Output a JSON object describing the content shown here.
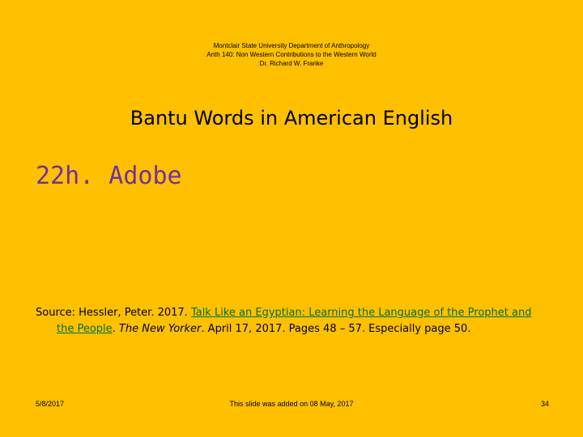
{
  "header": {
    "line1": "Montclair State University Department of Anthropology",
    "line2": "Anth 140: Non Western Contributions to the Western World",
    "line3": "Dr. Richard W. Franke"
  },
  "slide": {
    "title": "Bantu Words in American English",
    "subtitle": "22h. Adobe"
  },
  "source": {
    "prefix": "Source: Hessler, Peter. 2017. ",
    "link_part1": "Talk Like an Egyptian: Learning the Language of the Prophet and",
    "link_part2": "the People",
    "dot": ". ",
    "publication": "The New Yorker",
    "suffix": ". April 17, 2017. Pages 48 – 57.  Especially page 50."
  },
  "footer": {
    "date": "5/8/2017",
    "note": "This slide was added on 08 May, 2017",
    "page": "34"
  },
  "colors": {
    "background": "#FFC000",
    "subtitle": "#7030A0",
    "link": "#00703C"
  }
}
